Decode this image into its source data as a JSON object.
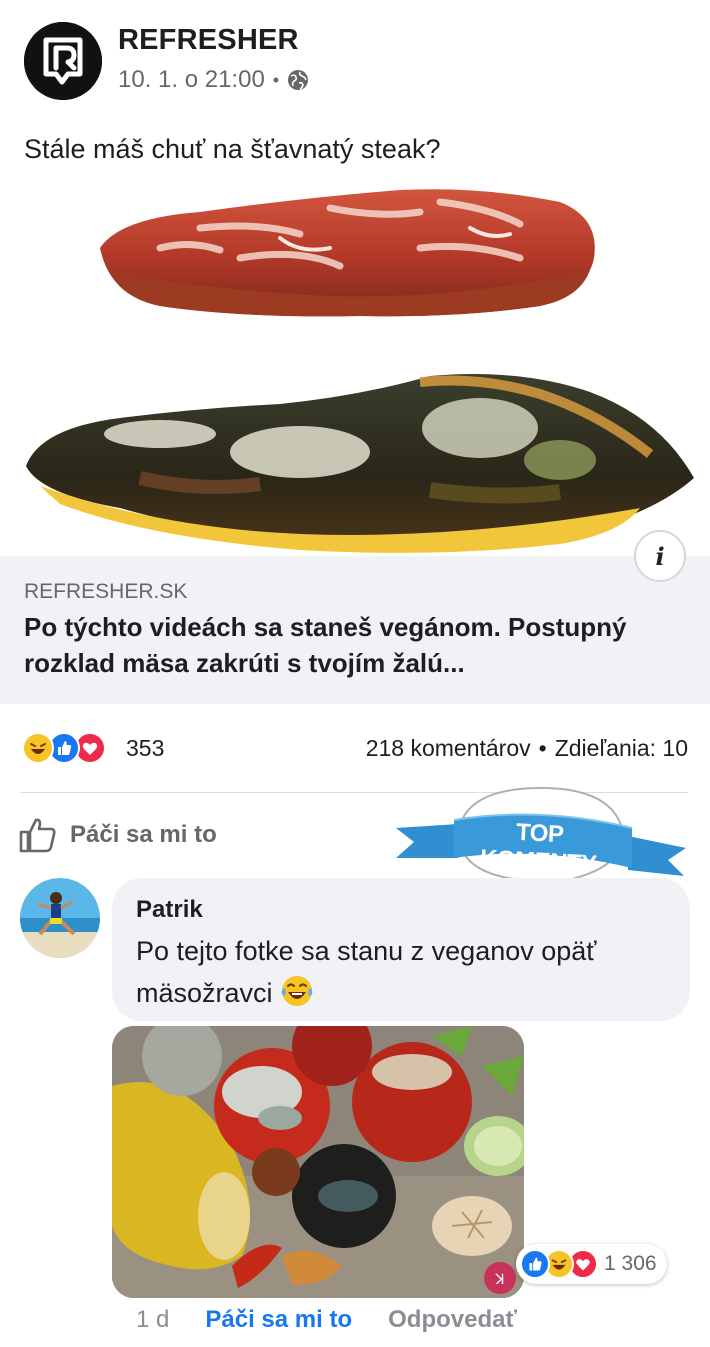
{
  "post": {
    "page_name": "REFRESHER",
    "timestamp": "10. 1. o 21:00",
    "meta_separator": "•",
    "privacy_icon": "globe-icon",
    "text": "Stále máš chuť na šťavnatý steak?"
  },
  "link_preview": {
    "domain": "REFRESHER.SK",
    "title": "Po týchto videách sa staneš vegánom. Postupný rozklad mäsa zakrúti s tvojím žalú...",
    "info_icon": "info-icon",
    "info_label": "i"
  },
  "engagement": {
    "reaction_icons": [
      "haha-icon",
      "like-icon",
      "love-icon"
    ],
    "reaction_count": "353",
    "comments": "218 komentárov",
    "separator": "•",
    "shares": "Zdieľania: 10"
  },
  "actions": {
    "like_label": "Páči sa mi to",
    "like_icon": "thumbs-up-icon"
  },
  "top_comments_badge": "TOP KOMENTY",
  "comment": {
    "author": "Patrik",
    "text": "Po tejto fotke sa stanu z veganov opäť mäsožravci",
    "emoji": "laughing-tears-emoji",
    "reaction_icons": [
      "like-icon",
      "haha-icon",
      "love-icon"
    ],
    "reaction_count": "1 306",
    "age": "1 d",
    "like_label": "Páči sa mi to",
    "reply_label": "Odpovedať"
  },
  "colors": {
    "facebook_blue": "#1877f2",
    "ribbon_blue": "#2f8fd0",
    "bubble_gray": "#f0f2f5",
    "secondary_text": "#65676b"
  }
}
